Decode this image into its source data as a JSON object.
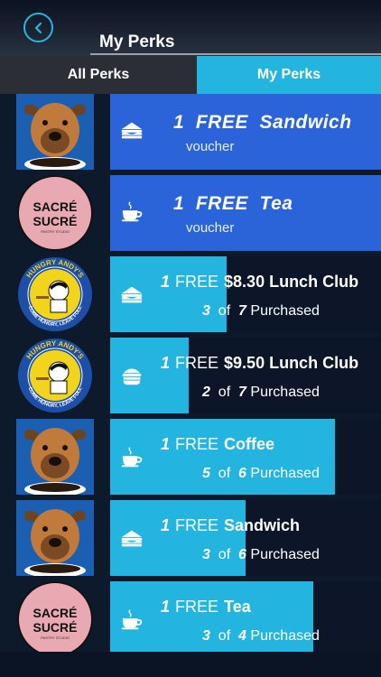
{
  "header": {
    "title": "My Perks"
  },
  "tabs": [
    {
      "label": "All Perks",
      "active": false
    },
    {
      "label": "My Perks",
      "active": true
    }
  ],
  "colors": {
    "accent": "#23b5e0",
    "voucher_blue": "#2a64d8",
    "card_dark": "#0c1628"
  },
  "perks": [
    {
      "vendor": "dog",
      "kind": "voucher",
      "icon": "sandwich-icon",
      "count": "1",
      "free": "FREE",
      "item": "Sandwich",
      "subtitle": "voucher"
    },
    {
      "vendor": "sacre",
      "kind": "voucher",
      "icon": "cup-icon",
      "count": "1",
      "free": "FREE",
      "item": "Tea",
      "subtitle": "voucher"
    },
    {
      "vendor": "andy",
      "kind": "progress",
      "icon": "sandwich-icon",
      "count": "1",
      "free": "FREE",
      "item": "$8.30 Lunch Club",
      "done": "3",
      "of": "of",
      "total": "7",
      "purchased": "Purchased",
      "progress": 0.43
    },
    {
      "vendor": "andy",
      "kind": "progress",
      "icon": "burger-icon",
      "count": "1",
      "free": "FREE",
      "item": "$9.50 Lunch Club",
      "done": "2",
      "of": "of",
      "total": "7",
      "purchased": "Purchased",
      "progress": 0.29
    },
    {
      "vendor": "dog",
      "kind": "progress",
      "icon": "cup-icon",
      "count": "1",
      "free": "FREE",
      "item": "Coffee",
      "done": "5",
      "of": "of",
      "total": "6",
      "purchased": "Purchased",
      "progress": 0.83
    },
    {
      "vendor": "dog",
      "kind": "progress",
      "icon": "sandwich-icon",
      "count": "1",
      "free": "FREE",
      "item": "Sandwich",
      "done": "3",
      "of": "of",
      "total": "6",
      "purchased": "Purchased",
      "progress": 0.5
    },
    {
      "vendor": "sacre",
      "kind": "progress",
      "icon": "cup-icon",
      "count": "1",
      "free": "FREE",
      "item": "Tea",
      "done": "3",
      "of": "of",
      "total": "4",
      "purchased": "Purchased",
      "progress": 0.75
    }
  ],
  "logos": {
    "sacre": {
      "line1": "SACRÉ",
      "line2": "SUCRÉ",
      "small": "PASTRY STUDIO"
    },
    "andy": {
      "top": "HUNGRY ANDY'S",
      "bottom": "COME HUNGRY, LEAVE FULL"
    }
  }
}
